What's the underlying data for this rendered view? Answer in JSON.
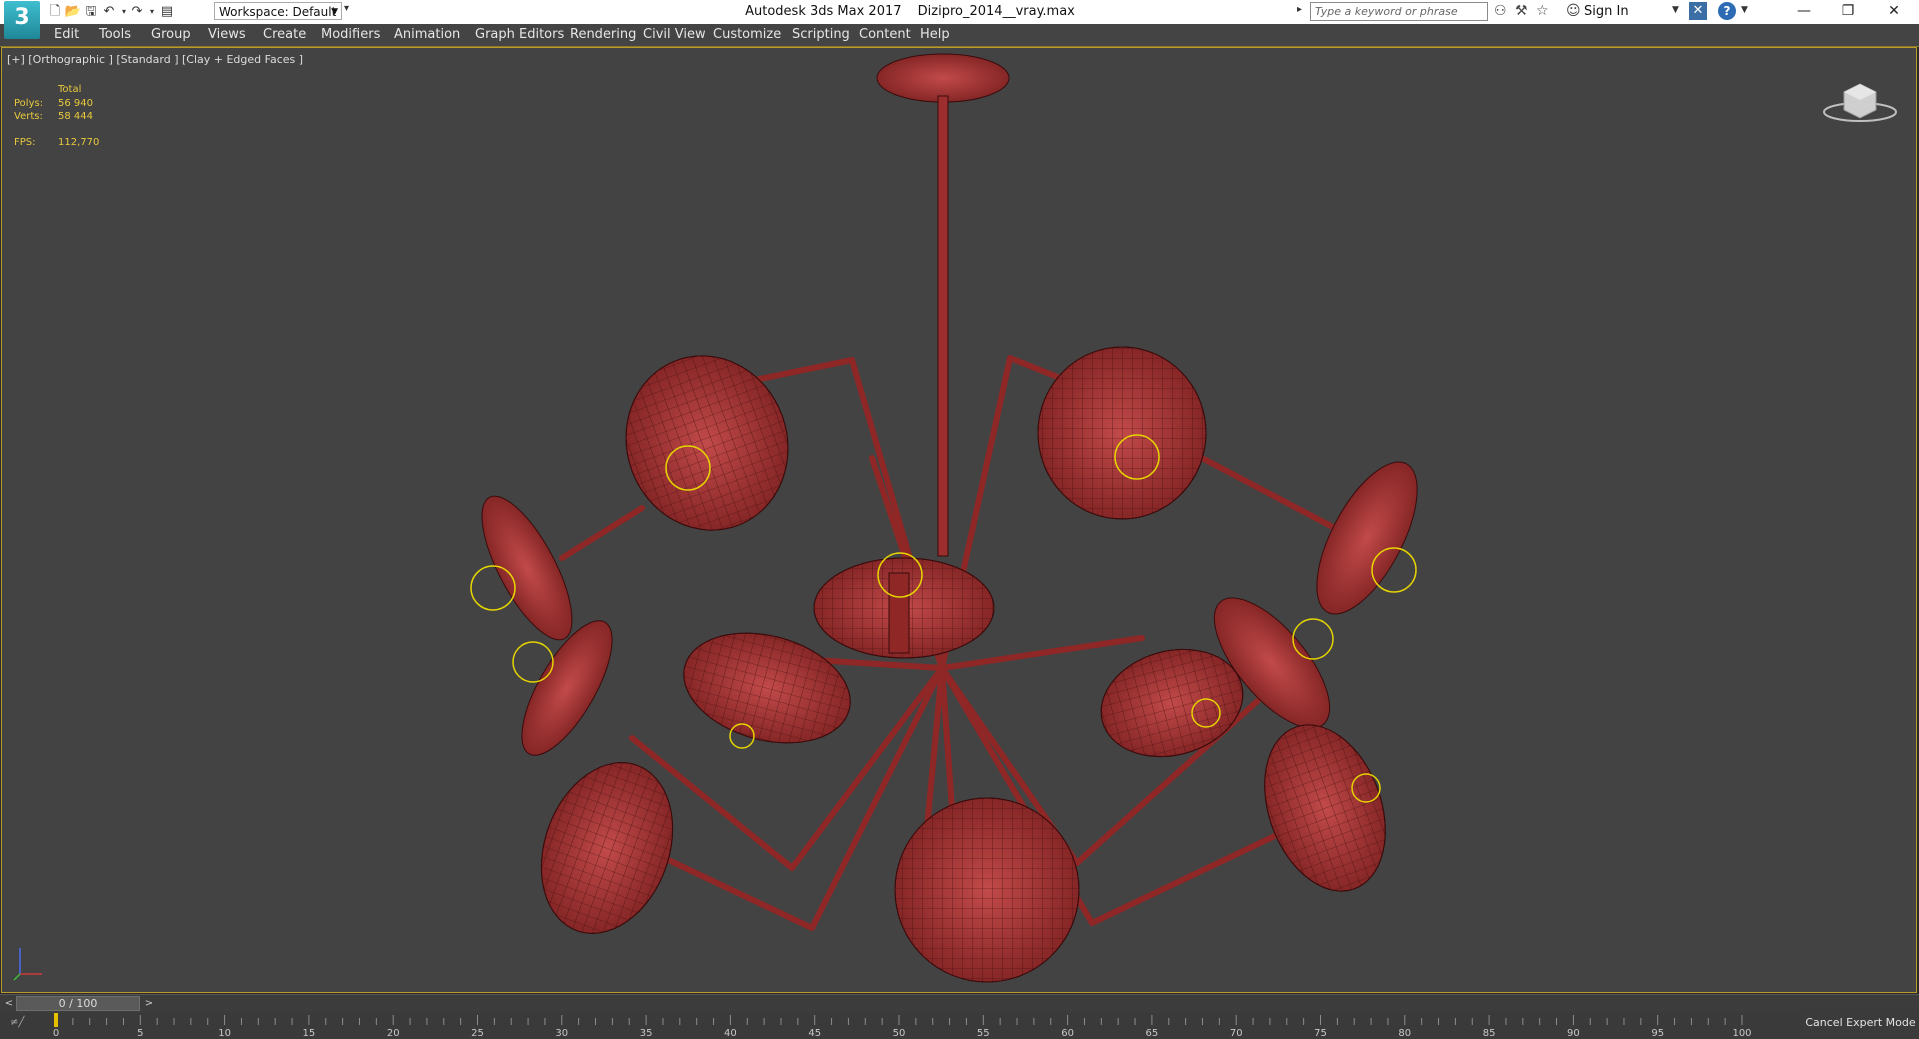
{
  "titlebar": {
    "app_logo": "3",
    "workspace": "Workspace: Default",
    "app_name": "Autodesk 3ds Max 2017",
    "file_name": "Dizipro_2014__vray.max",
    "search_placeholder": "Type a keyword or phrase",
    "sign_in": "Sign In",
    "help": "?"
  },
  "menu": [
    "Edit",
    "Tools",
    "Group",
    "Views",
    "Create",
    "Modifiers",
    "Animation",
    "Graph Editors",
    "Rendering",
    "Civil View",
    "Customize",
    "Scripting",
    "Content",
    "Help"
  ],
  "viewport": {
    "label": "[+] [Orthographic ] [Standard ] [Clay + Edged Faces ]",
    "stats": {
      "header": "Total",
      "polys_label": "Polys:",
      "polys_value": "56 940",
      "verts_label": "Verts:",
      "verts_value": "58 444",
      "fps_label": "FPS:",
      "fps_value": "112,770"
    },
    "model_color": "#b33a3a",
    "helper_color": "#e5d400"
  },
  "timeslider": {
    "prev": "<",
    "position": "0 / 100",
    "next": ">"
  },
  "trackbar": {
    "ticks": [
      "0",
      "5",
      "10",
      "15",
      "20",
      "25",
      "30",
      "35",
      "40",
      "45",
      "50",
      "55",
      "60",
      "65",
      "70",
      "75",
      "80",
      "85",
      "90",
      "95",
      "100"
    ]
  },
  "cancel_expert_mode": "Cancel Expert Mode",
  "icons": [
    "new-file-icon",
    "open-file-icon",
    "save-icon",
    "undo-icon",
    "redo-icon",
    "project-folder-icon",
    "binoculars-icon",
    "star-icon",
    "user-icon",
    "exchange-icon",
    "help-icon",
    "viewcube-icon",
    "axis-tripod-icon",
    "key-icon"
  ]
}
